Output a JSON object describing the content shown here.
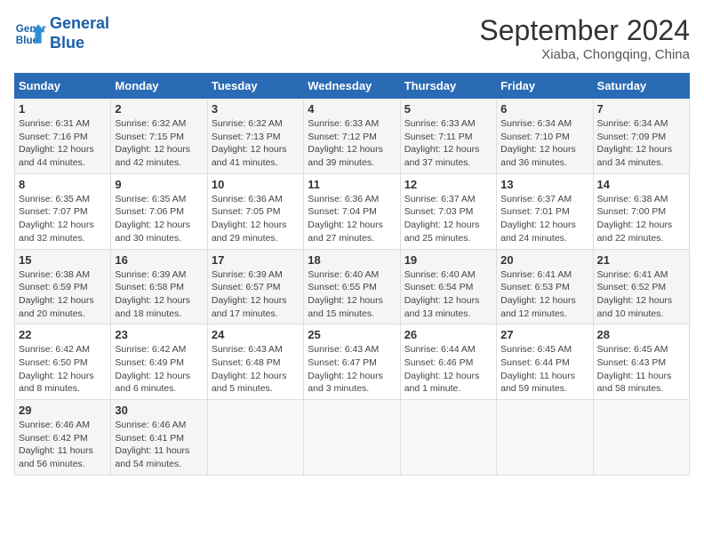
{
  "header": {
    "logo_line1": "General",
    "logo_line2": "Blue",
    "month_title": "September 2024",
    "location": "Xiaba, Chongqing, China"
  },
  "weekdays": [
    "Sunday",
    "Monday",
    "Tuesday",
    "Wednesday",
    "Thursday",
    "Friday",
    "Saturday"
  ],
  "weeks": [
    [
      {
        "day": "1",
        "sunrise": "6:31 AM",
        "sunset": "7:16 PM",
        "daylight": "12 hours and 44 minutes."
      },
      {
        "day": "2",
        "sunrise": "6:32 AM",
        "sunset": "7:15 PM",
        "daylight": "12 hours and 42 minutes."
      },
      {
        "day": "3",
        "sunrise": "6:32 AM",
        "sunset": "7:13 PM",
        "daylight": "12 hours and 41 minutes."
      },
      {
        "day": "4",
        "sunrise": "6:33 AM",
        "sunset": "7:12 PM",
        "daylight": "12 hours and 39 minutes."
      },
      {
        "day": "5",
        "sunrise": "6:33 AM",
        "sunset": "7:11 PM",
        "daylight": "12 hours and 37 minutes."
      },
      {
        "day": "6",
        "sunrise": "6:34 AM",
        "sunset": "7:10 PM",
        "daylight": "12 hours and 36 minutes."
      },
      {
        "day": "7",
        "sunrise": "6:34 AM",
        "sunset": "7:09 PM",
        "daylight": "12 hours and 34 minutes."
      }
    ],
    [
      {
        "day": "8",
        "sunrise": "6:35 AM",
        "sunset": "7:07 PM",
        "daylight": "12 hours and 32 minutes."
      },
      {
        "day": "9",
        "sunrise": "6:35 AM",
        "sunset": "7:06 PM",
        "daylight": "12 hours and 30 minutes."
      },
      {
        "day": "10",
        "sunrise": "6:36 AM",
        "sunset": "7:05 PM",
        "daylight": "12 hours and 29 minutes."
      },
      {
        "day": "11",
        "sunrise": "6:36 AM",
        "sunset": "7:04 PM",
        "daylight": "12 hours and 27 minutes."
      },
      {
        "day": "12",
        "sunrise": "6:37 AM",
        "sunset": "7:03 PM",
        "daylight": "12 hours and 25 minutes."
      },
      {
        "day": "13",
        "sunrise": "6:37 AM",
        "sunset": "7:01 PM",
        "daylight": "12 hours and 24 minutes."
      },
      {
        "day": "14",
        "sunrise": "6:38 AM",
        "sunset": "7:00 PM",
        "daylight": "12 hours and 22 minutes."
      }
    ],
    [
      {
        "day": "15",
        "sunrise": "6:38 AM",
        "sunset": "6:59 PM",
        "daylight": "12 hours and 20 minutes."
      },
      {
        "day": "16",
        "sunrise": "6:39 AM",
        "sunset": "6:58 PM",
        "daylight": "12 hours and 18 minutes."
      },
      {
        "day": "17",
        "sunrise": "6:39 AM",
        "sunset": "6:57 PM",
        "daylight": "12 hours and 17 minutes."
      },
      {
        "day": "18",
        "sunrise": "6:40 AM",
        "sunset": "6:55 PM",
        "daylight": "12 hours and 15 minutes."
      },
      {
        "day": "19",
        "sunrise": "6:40 AM",
        "sunset": "6:54 PM",
        "daylight": "12 hours and 13 minutes."
      },
      {
        "day": "20",
        "sunrise": "6:41 AM",
        "sunset": "6:53 PM",
        "daylight": "12 hours and 12 minutes."
      },
      {
        "day": "21",
        "sunrise": "6:41 AM",
        "sunset": "6:52 PM",
        "daylight": "12 hours and 10 minutes."
      }
    ],
    [
      {
        "day": "22",
        "sunrise": "6:42 AM",
        "sunset": "6:50 PM",
        "daylight": "12 hours and 8 minutes."
      },
      {
        "day": "23",
        "sunrise": "6:42 AM",
        "sunset": "6:49 PM",
        "daylight": "12 hours and 6 minutes."
      },
      {
        "day": "24",
        "sunrise": "6:43 AM",
        "sunset": "6:48 PM",
        "daylight": "12 hours and 5 minutes."
      },
      {
        "day": "25",
        "sunrise": "6:43 AM",
        "sunset": "6:47 PM",
        "daylight": "12 hours and 3 minutes."
      },
      {
        "day": "26",
        "sunrise": "6:44 AM",
        "sunset": "6:46 PM",
        "daylight": "12 hours and 1 minute."
      },
      {
        "day": "27",
        "sunrise": "6:45 AM",
        "sunset": "6:44 PM",
        "daylight": "11 hours and 59 minutes."
      },
      {
        "day": "28",
        "sunrise": "6:45 AM",
        "sunset": "6:43 PM",
        "daylight": "11 hours and 58 minutes."
      }
    ],
    [
      {
        "day": "29",
        "sunrise": "6:46 AM",
        "sunset": "6:42 PM",
        "daylight": "11 hours and 56 minutes."
      },
      {
        "day": "30",
        "sunrise": "6:46 AM",
        "sunset": "6:41 PM",
        "daylight": "11 hours and 54 minutes."
      },
      null,
      null,
      null,
      null,
      null
    ]
  ],
  "labels": {
    "sunrise": "Sunrise:",
    "sunset": "Sunset:",
    "daylight": "Daylight:"
  }
}
